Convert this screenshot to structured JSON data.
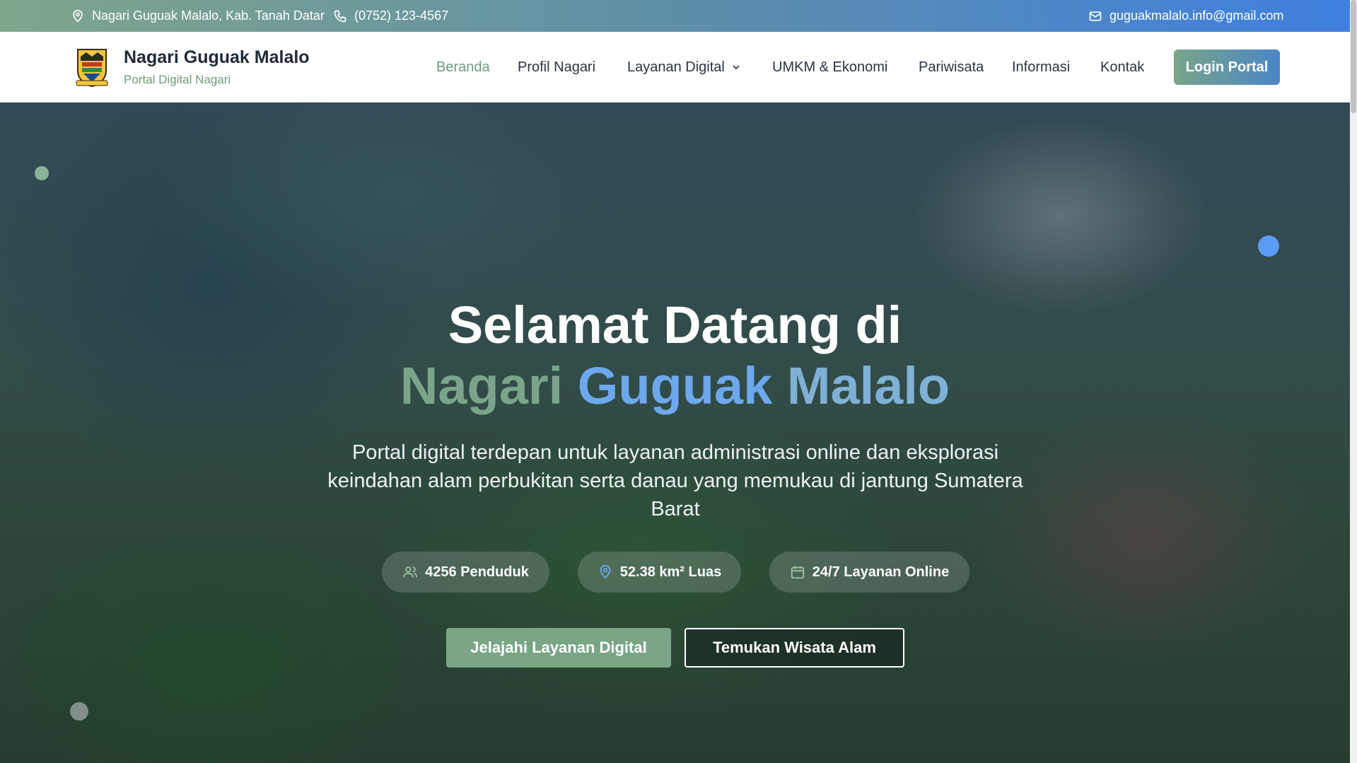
{
  "topbar": {
    "location": "Nagari Guguak Malalo, Kab. Tanah Datar",
    "phone": "(0752) 123-4567",
    "email": "guguakmalalo.info@gmail.com",
    "icons": {
      "location": "map-pin-icon",
      "phone": "phone-icon",
      "email": "mail-icon"
    }
  },
  "brand": {
    "title": "Nagari Guguak Malalo",
    "subtitle": "Portal Digital Nagari"
  },
  "nav": {
    "items": [
      {
        "label": "Beranda",
        "active": true
      },
      {
        "label": "Profil Nagari"
      },
      {
        "label": "Layanan Digital",
        "dropdown": true
      },
      {
        "label": "UMKM & Ekonomi"
      },
      {
        "label": "Pariwisata"
      },
      {
        "label": "Informasi"
      },
      {
        "label": "Kontak"
      }
    ],
    "login_label": "Login Portal"
  },
  "hero": {
    "title_line1": "Selamat Datang di",
    "title_line2": {
      "w1": "Nagari",
      "w2": "Guguak",
      "w3": "Malalo"
    },
    "description": "Portal digital terdepan untuk layanan administrasi online dan eksplorasi keindahan alam perbukitan serta danau yang memukau di jantung Sumatera Barat",
    "stats": [
      {
        "icon": "users-icon",
        "label": "4256 Penduduk"
      },
      {
        "icon": "map-pin-icon",
        "label": "52.38 km² Luas"
      },
      {
        "icon": "calendar-icon",
        "label": "24/7 Layanan Online"
      }
    ],
    "cta_primary": "Jelajahi Layanan Digital",
    "cta_secondary": "Temukan Wisata Alam"
  },
  "colors": {
    "accent_green": "#7aa587",
    "accent_blue": "#4a86c9",
    "text_dark": "#1f2a37"
  }
}
